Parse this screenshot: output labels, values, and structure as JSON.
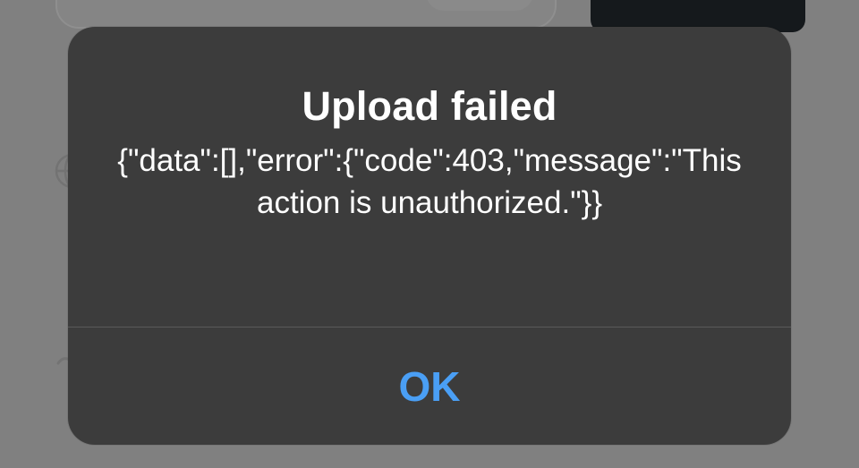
{
  "alert": {
    "title": "Upload failed",
    "message": "{\"data\":[],\"error\":{\"code\":403,\"message\":\"This action is unauthorized.\"}}",
    "ok_label": "OK"
  },
  "background": {
    "icons": [
      "globe-icon",
      "chevron-mark-icon"
    ]
  },
  "colors": {
    "dimmed_background": "#808080",
    "alert_background": "#3c3c3c",
    "alert_text": "#ffffff",
    "button_accent": "#4a9ff5",
    "divider": "#5a5a5a"
  }
}
